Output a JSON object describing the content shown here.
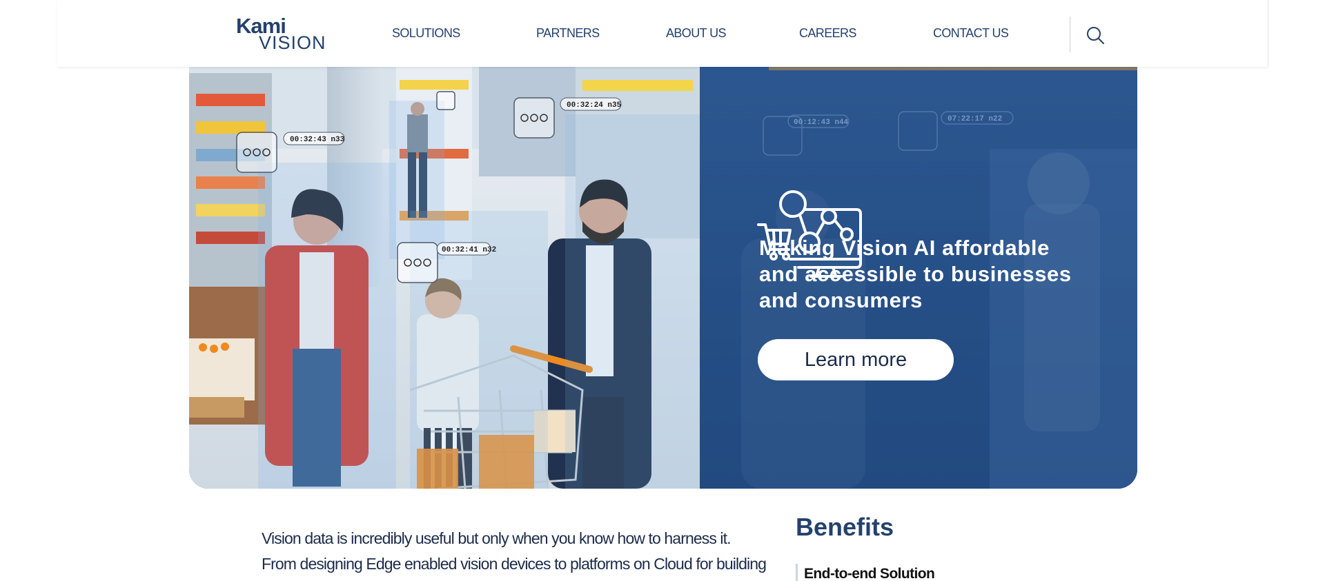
{
  "header": {
    "logo_top": "Kami",
    "logo_bottom": "VISION",
    "nav": [
      {
        "label": "SOLUTIONS"
      },
      {
        "label": "PARTNERS"
      },
      {
        "label": "ABOUT US"
      },
      {
        "label": "CAREERS"
      },
      {
        "label": "CONTACT US"
      }
    ],
    "search_icon": "search-icon"
  },
  "hero": {
    "headline": "Making Vision AI affordable and accessible to businesses and consumers",
    "cta_label": "Learn more",
    "icon": "cart-network-monitor-icon",
    "detection_tags": [
      "00:32:43 n33",
      "00:32:24 n35",
      "00:32:41 n32",
      "00:12:43 n44",
      "07:22:17 n22"
    ],
    "accent_color": "#24416e"
  },
  "content": {
    "intro_text": "Vision data is incredibly useful but only when you know how to harness it. From designing Edge enabled vision devices to platforms on Cloud for building",
    "benefits_title": "Benefits",
    "benefits": [
      {
        "label": "End-to-end Solution"
      }
    ]
  }
}
